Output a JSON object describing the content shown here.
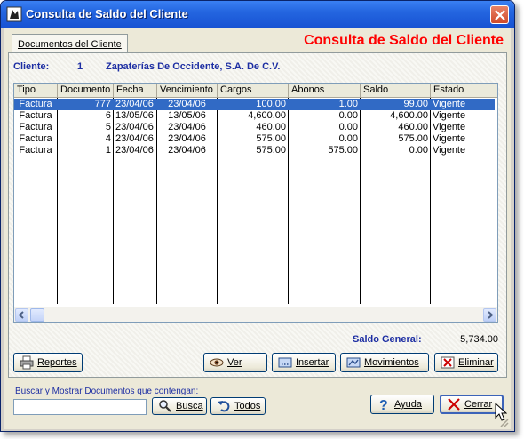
{
  "window": {
    "title": "Consulta de Saldo del Cliente"
  },
  "tab": {
    "label": "Documentos del Cliente"
  },
  "header": {
    "big_title": "Consulta de Saldo del Cliente"
  },
  "client": {
    "label": "Cliente:",
    "number": "1",
    "name": "Zapaterías De Occidente, S.A. De C.V."
  },
  "table": {
    "columns": [
      "Tipo",
      "Documento",
      "Fecha",
      "Vencimiento",
      "Cargos",
      "Abonos",
      "Saldo",
      "Estado"
    ],
    "rows": [
      [
        "Factura",
        "777",
        "23/04/06",
        "23/04/06",
        "100.00",
        "1.00",
        "99.00",
        "Vigente"
      ],
      [
        "Factura",
        "6",
        "13/05/06",
        "13/05/06",
        "4,600.00",
        "0.00",
        "4,600.00",
        "Vigente"
      ],
      [
        "Factura",
        "5",
        "23/04/06",
        "23/04/06",
        "460.00",
        "0.00",
        "460.00",
        "Vigente"
      ],
      [
        "Factura",
        "4",
        "23/04/06",
        "23/04/06",
        "575.00",
        "0.00",
        "575.00",
        "Vigente"
      ],
      [
        "Factura",
        "1",
        "23/04/06",
        "23/04/06",
        "575.00",
        "575.00",
        "0.00",
        "Vigente"
      ]
    ],
    "selected_row": 0
  },
  "saldo": {
    "label": "Saldo General:",
    "value": "5,734.00"
  },
  "buttons": {
    "reportes": "Reportes",
    "ver": "Ver",
    "insertar": "Insertar",
    "movimientos": "Movimientos",
    "eliminar": "Eliminar",
    "busca": "Busca",
    "todos": "Todos",
    "ayuda": "Ayuda",
    "cerrar": "Cerrar"
  },
  "search": {
    "label": "Buscar y Mostrar Documentos que contengan:",
    "value": ""
  },
  "colors": {
    "title_red": "#ff0000",
    "label_blue": "#1d2ea3",
    "selection": "#316ac5"
  }
}
